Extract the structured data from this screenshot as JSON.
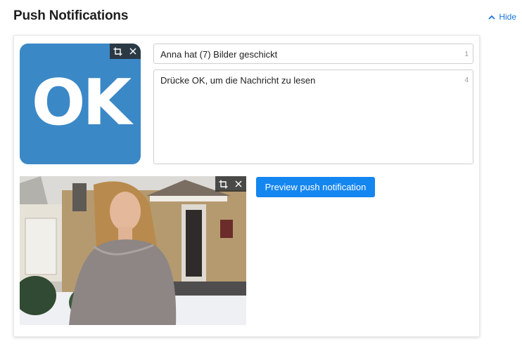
{
  "header": {
    "title": "Push Notifications",
    "hide_label": "Hide"
  },
  "icon_image": {
    "text": "OK",
    "background_color": "#3b88c7"
  },
  "title_field": {
    "value": "Anna hat (7) Bilder geschickt",
    "counter": "1"
  },
  "body_field": {
    "value": "Drücke OK, um die Nachricht zu lesen",
    "counter": "4"
  },
  "preview_button": {
    "label": "Preview push notification",
    "color": "#1486f0"
  },
  "icons": {
    "crop": "crop-icon",
    "close": "close-icon",
    "chevron": "chevron-up-icon"
  },
  "accent_color": "#1a73d9"
}
